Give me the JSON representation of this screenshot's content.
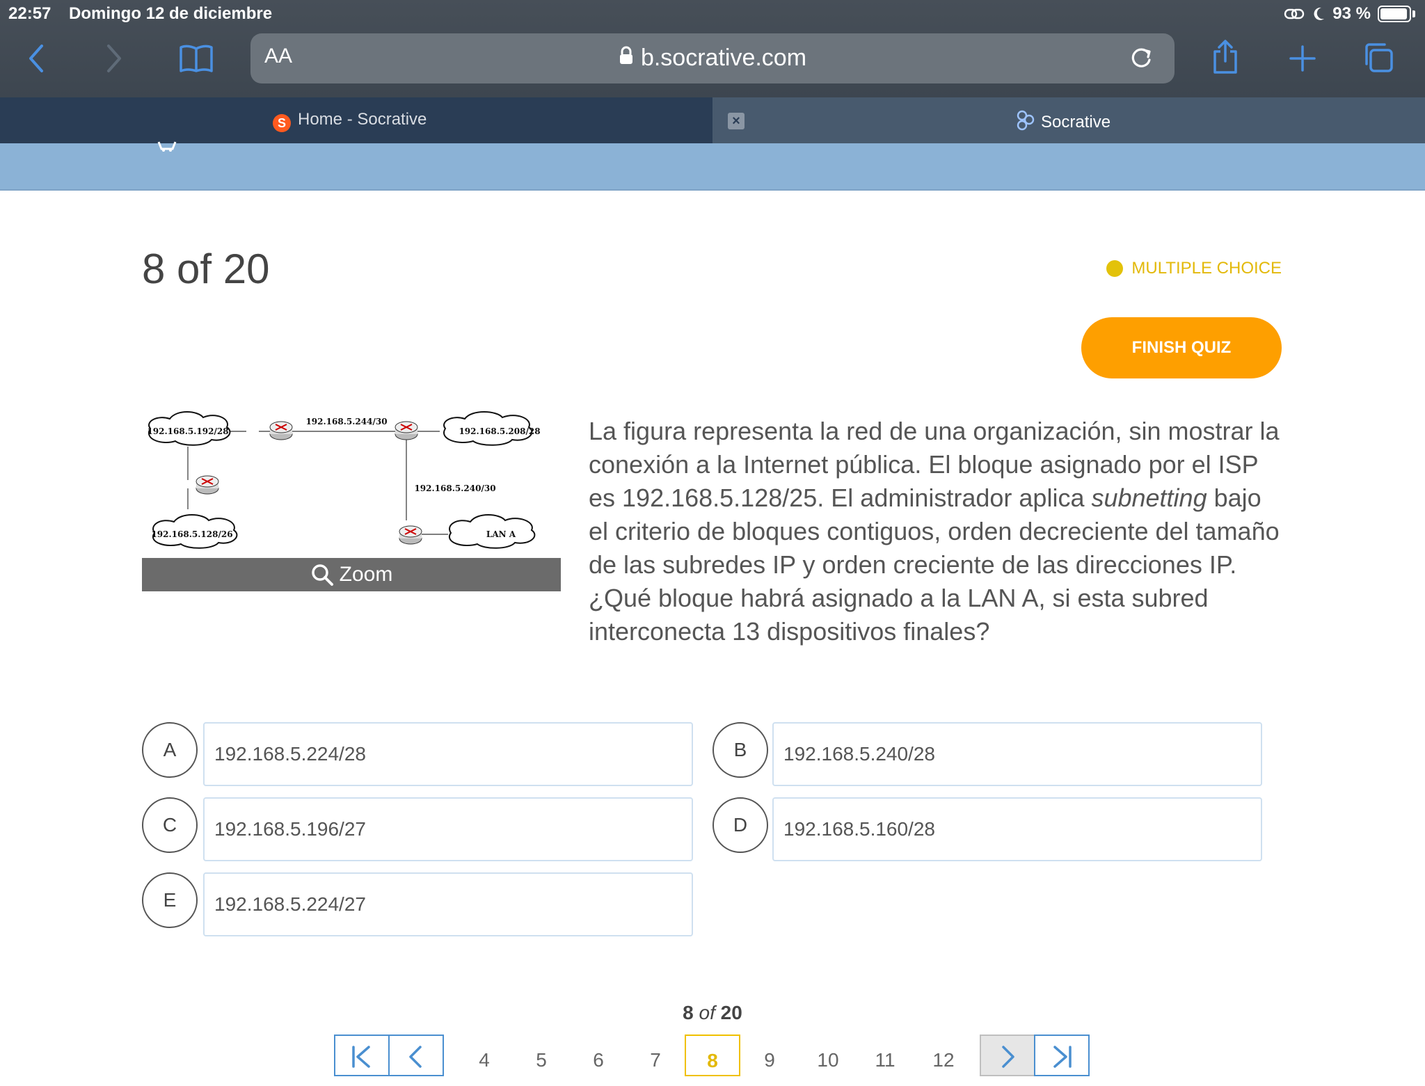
{
  "status_bar": {
    "time": "22:57",
    "date": "Domingo 12 de diciembre",
    "battery": "93 %"
  },
  "browser": {
    "text_size_label": "AA",
    "url": "b.socrative.com"
  },
  "tabs": [
    {
      "label": "Home - Socrative",
      "active": false
    },
    {
      "label": "Socrative",
      "active": true
    }
  ],
  "quiz": {
    "counter": "8 of 20",
    "question_type": "MULTIPLE CHOICE",
    "finish_label": "FINISH QUIZ",
    "zoom_label": "Zoom",
    "question_pre": "La figura representa la red de una organización, sin mostrar la conexión a la Internet pública. El bloque asignado por el ISP es 192.168.5.128/25. El administrador aplica ",
    "question_italic": "subnetting",
    "question_post": " bajo el criterio de bloques contiguos, orden decreciente del tamaño de las subredes IP y orden creciente de las direcciones IP. ¿Qué bloque habrá asignado a la LAN A, si esta subred interconecta 13 dispositivos finales?",
    "figure": {
      "cloud_1": "192.168.5.192/28",
      "cloud_2": "192.168.5.208/28",
      "cloud_3": "192.168.5.128/26",
      "cloud_4": "LAN A",
      "link_top": "192.168.5.244/30",
      "link_right": "192.168.5.240/30"
    },
    "choices": [
      {
        "letter": "A",
        "text": "192.168.5.224/28"
      },
      {
        "letter": "B",
        "text": "192.168.5.240/28"
      },
      {
        "letter": "C",
        "text": "192.168.5.196/27"
      },
      {
        "letter": "D",
        "text": "192.168.5.160/28"
      },
      {
        "letter": "E",
        "text": "192.168.5.224/27"
      }
    ]
  },
  "pagination": {
    "current": "8",
    "of_word": "of",
    "total": "20",
    "pages": [
      "4",
      "5",
      "6",
      "7",
      "8",
      "9",
      "10",
      "11",
      "12"
    ]
  }
}
